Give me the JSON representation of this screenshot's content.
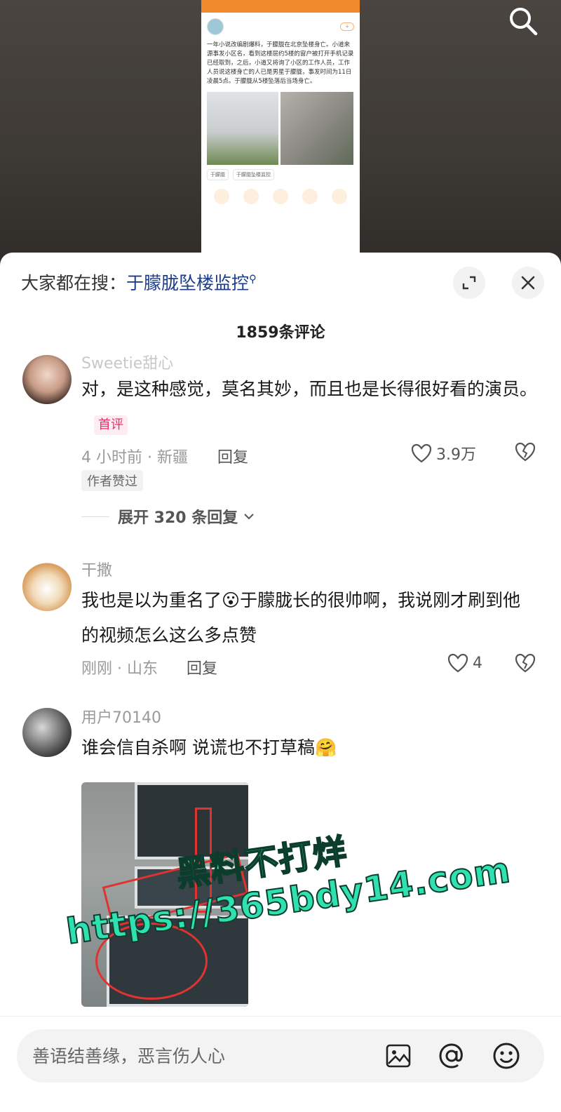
{
  "video": {
    "phone_screenshot": {
      "post_text": "一年小说改编剧爆料，于朦胧在北京坠楼身亡。小道来源事发小区名，看到这楼层约5楼的窗户被打开手机记录已经取到，之后，小道又将询了小区的工作人员，工作人员说这楼身亡的人已是男星于朦胧，事发时间为11日凌晨5点。于朦胧从5楼坠落后当场身亡。",
      "tags": [
        "于朦胧",
        "于朦胧坠楼监控"
      ]
    }
  },
  "sheet": {
    "hot_search_label": "大家都在搜：",
    "hot_search_keyword": "于朦胧坠楼监控",
    "comment_count": "1859条评论"
  },
  "comments": [
    {
      "user": "Sweetie甜心",
      "text": "对，是这种感觉，莫名其妙，而且也是长得很好看的演员。",
      "badge": "首评",
      "meta": "4 小时前 · 新疆",
      "reply": "回复",
      "likes": "3.9万",
      "author_liked": "作者赞过",
      "expand": "展开 320 条回复"
    },
    {
      "user": "干撒",
      "text_before_emoji": "我也是以为重名了",
      "emoji": "😮",
      "text_after_emoji": "于朦胧长的很帅啊，我说刚才刷到他的视频怎么这么多点赞",
      "meta": "刚刚 · 山东",
      "reply": "回复",
      "likes": "4"
    },
    {
      "user": "用户70140",
      "text": "谁会信自杀啊 说谎也不打草稿",
      "emoji": "🤗"
    }
  ],
  "watermark": {
    "line1": "黑料不打烊",
    "line2": "https://365bdy14.com"
  },
  "input": {
    "placeholder": "善语结善缘，恶言伤人心"
  },
  "icons": {
    "search": "search-icon",
    "expand": "expand-icon",
    "close": "close-icon",
    "heart": "heart-icon",
    "dislike": "broken-heart-icon",
    "image": "image-icon",
    "at": "at-icon",
    "emoji": "emoji-icon"
  },
  "colors": {
    "keyword": "#1b3d8c",
    "badge": "#ea2f63",
    "watermark": "#2fe0b0"
  }
}
